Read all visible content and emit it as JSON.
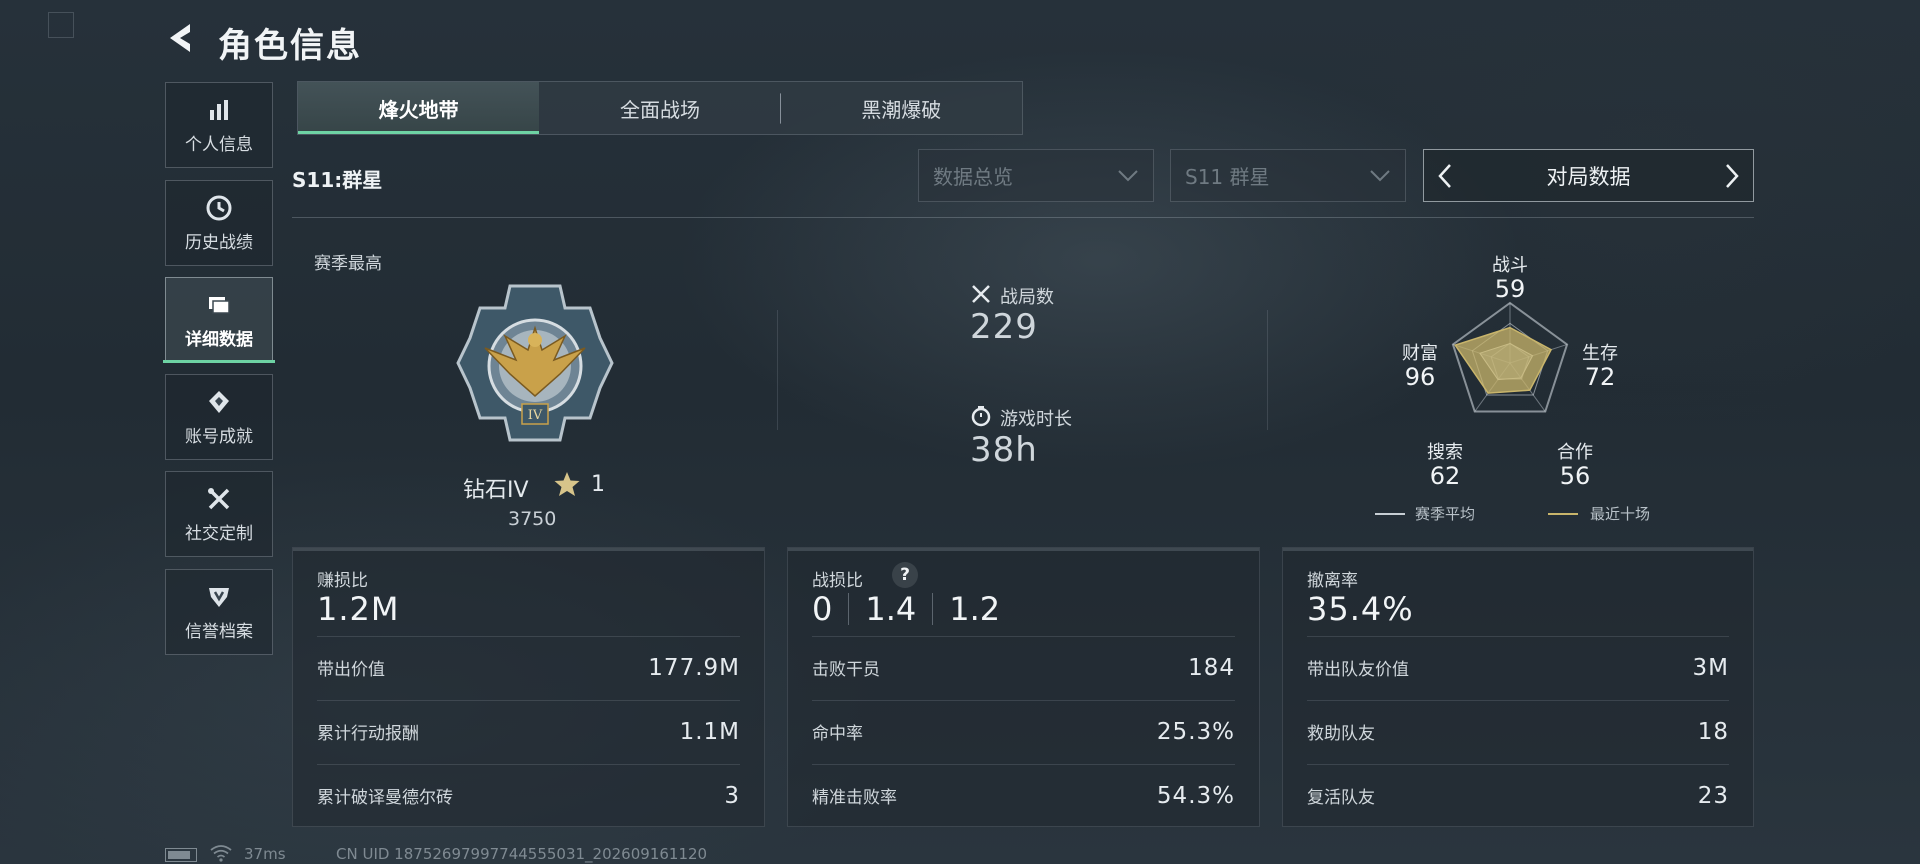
{
  "header": {
    "title": "角色信息"
  },
  "sidebar": {
    "items": [
      {
        "label": "个人信息",
        "icon": "bar-chart-icon"
      },
      {
        "label": "历史战绩",
        "icon": "clock-icon"
      },
      {
        "label": "详细数据",
        "icon": "data-cards-icon",
        "active": true
      },
      {
        "label": "账号成就",
        "icon": "achievement-icon"
      },
      {
        "label": "社交定制",
        "icon": "tools-icon"
      },
      {
        "label": "信誉档案",
        "icon": "shield-icon"
      }
    ]
  },
  "tabs": [
    {
      "label": "烽火地带",
      "active": true
    },
    {
      "label": "全面战场"
    },
    {
      "label": "黑潮爆破"
    }
  ],
  "season": {
    "label": "S11:群星"
  },
  "filters": {
    "overview": "数据总览",
    "season": "S11 群星",
    "pager_label": "对局数据"
  },
  "rank": {
    "section_label": "赛季最高",
    "name": "钻石IV",
    "stars": "1",
    "score": "3750",
    "medal_text": "IV"
  },
  "stats": {
    "matches_label": "战局数",
    "matches_value": "229",
    "playtime_label": "游戏时长",
    "playtime_value": "38h"
  },
  "radar": {
    "axes": [
      {
        "label": "战斗",
        "value": "59"
      },
      {
        "label": "生存",
        "value": "72"
      },
      {
        "label": "合作",
        "value": "56"
      },
      {
        "label": "搜索",
        "value": "62"
      },
      {
        "label": "财富",
        "value": "96"
      }
    ],
    "legend": [
      {
        "label": "赛季平均",
        "color": "#c7ced4"
      },
      {
        "label": "最近十场",
        "color": "#c9b56b"
      }
    ],
    "fill_color": "#c9b56b"
  },
  "cards": {
    "profit": {
      "title": "赚损比",
      "big": "1.2M",
      "rows": [
        {
          "k": "带出价值",
          "v": "177.9M"
        },
        {
          "k": "累计行动报酬",
          "v": "1.1M"
        },
        {
          "k": "累计破译曼德尔砖",
          "v": "3"
        }
      ]
    },
    "combat": {
      "title": "战损比",
      "help": "?",
      "kd": [
        "0",
        "1.4",
        "1.2"
      ],
      "rows": [
        {
          "k": "击败干员",
          "v": "184"
        },
        {
          "k": "命中率",
          "v": "25.3%"
        },
        {
          "k": "精准击败率",
          "v": "54.3%"
        }
      ]
    },
    "extract": {
      "title": "撤离率",
      "big": "35.4%",
      "rows": [
        {
          "k": "带出队友价值",
          "v": "3M"
        },
        {
          "k": "救助队友",
          "v": "18"
        },
        {
          "k": "复活队友",
          "v": "23"
        }
      ]
    }
  },
  "status": {
    "ping": "37ms",
    "uid": "CN UID 18752697997744555031_202609161120"
  }
}
